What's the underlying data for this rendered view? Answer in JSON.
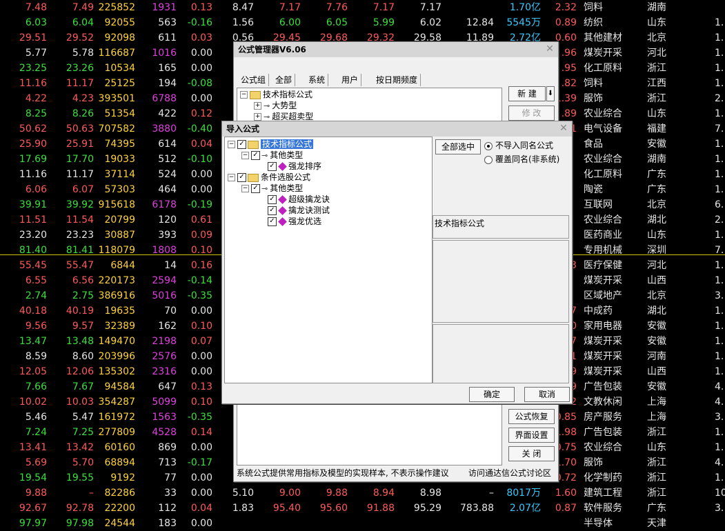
{
  "table": {
    "rows": [
      {
        "c1": "7.48",
        "c2": "7.49",
        "c3": "225852",
        "c4": "1931",
        "c5": "0.13",
        "c6": "8.47",
        "c7": "7.17",
        "c8": "7.76",
        "c9": "7.17",
        "c10": "7.17",
        "c11": "",
        "c12": "1.70亿",
        "c13": "2.32",
        "c14": "饲料",
        "c15": "湖南",
        "c16": ""
      },
      {
        "c1": "6.03",
        "c2": "6.04",
        "c3": "92055",
        "c4": "563",
        "c5": "-0.16",
        "c6": "1.56",
        "c7": "6.00",
        "c8": "6.05",
        "c9": "5.99",
        "c10": "6.02",
        "c11": "12.84",
        "c12": "5545万",
        "c13": "0.89",
        "c14": "纺织",
        "c15": "山东",
        "c16": "1."
      },
      {
        "c1": "29.51",
        "c2": "29.52",
        "c3": "92098",
        "c4": "611",
        "c5": "0.03",
        "c6": "0.56",
        "c7": "29.45",
        "c8": "29.68",
        "c9": "29.32",
        "c10": "29.58",
        "c11": "11.89",
        "c12": "2.72亿",
        "c13": "0.60",
        "c14": "其他建材",
        "c15": "北京",
        "c16": "1."
      },
      {
        "c1": "5.77",
        "c2": "5.78",
        "c3": "116687",
        "c4": "1016",
        "c5": "0.00",
        "c13": ".96",
        "c14": "煤炭开采",
        "c15": "河北",
        "c16": "1."
      },
      {
        "c1": "23.25",
        "c2": "23.26",
        "c3": "10534",
        "c4": "165",
        "c5": "0.00",
        "c13": ".95",
        "c14": "化工原料",
        "c15": "浙江",
        "c16": "1."
      },
      {
        "c1": "11.16",
        "c2": "11.17",
        "c3": "25125",
        "c4": "194",
        "c5": "-0.08",
        "c13": ".82",
        "c14": "饲料",
        "c15": "江西",
        "c16": "1."
      },
      {
        "c1": "4.22",
        "c2": "4.23",
        "c3": "393501",
        "c4": "6788",
        "c5": "0.00",
        "c13": "1.39",
        "c14": "服饰",
        "c15": "浙江",
        "c16": "2."
      },
      {
        "c1": "8.25",
        "c2": "8.26",
        "c3": "51354",
        "c4": "422",
        "c5": "0.12",
        "c13": ".89",
        "c14": "农业综合",
        "c15": "山东",
        "c16": "1."
      },
      {
        "c1": "50.62",
        "c2": "50.63",
        "c3": "707582",
        "c4": "3880",
        "c5": "-0.40",
        "c13": "1",
        "c14": "电气设备",
        "c15": "福建",
        "c16": "7."
      },
      {
        "c1": "25.90",
        "c2": "25.91",
        "c3": "74395",
        "c4": "614",
        "c5": "0.04",
        "c13": "",
        "c14": "食品",
        "c15": "安徽",
        "c16": "1."
      },
      {
        "c1": "17.69",
        "c2": "17.70",
        "c3": "19033",
        "c4": "512",
        "c5": "-0.10",
        "c13": "",
        "c14": "农业综合",
        "c15": "湖南",
        "c16": "1."
      },
      {
        "c1": "11.16",
        "c2": "11.17",
        "c3": "37114",
        "c4": "524",
        "c5": "0.00",
        "c13": "",
        "c14": "化工原料",
        "c15": "广东",
        "c16": "1."
      },
      {
        "c1": "6.06",
        "c2": "6.07",
        "c3": "57303",
        "c4": "464",
        "c5": "0.00",
        "c13": "",
        "c14": "陶瓷",
        "c15": "广东",
        "c16": "1."
      },
      {
        "c1": "39.91",
        "c2": "39.92",
        "c3": "915618",
        "c4": "6178",
        "c5": "-0.19",
        "c13": "",
        "c14": "互联网",
        "c15": "北京",
        "c16": "6."
      },
      {
        "c1": "11.51",
        "c2": "11.54",
        "c3": "20799",
        "c4": "120",
        "c5": "0.61",
        "c13": "",
        "c14": "农业综合",
        "c15": "湖北",
        "c16": "2."
      },
      {
        "c1": "23.20",
        "c2": "23.23",
        "c3": "30887",
        "c4": "393",
        "c5": "0.09",
        "c13": "",
        "c14": "医药商业",
        "c15": "山东",
        "c16": "1."
      },
      {
        "c1": "81.40",
        "c2": "81.41",
        "c3": "118079",
        "c4": "1808",
        "c5": "0.10",
        "c13": "",
        "c14": "专用机械",
        "c15": "深圳",
        "c16": "7."
      },
      {
        "c1": "55.45",
        "c2": "55.47",
        "c3": "6844",
        "c4": "14",
        "c5": "0.16",
        "c13": "3",
        "c14": "医疗保健",
        "c15": "河北",
        "c16": "1."
      },
      {
        "c1": "6.55",
        "c2": "6.56",
        "c3": "220173",
        "c4": "2594",
        "c5": "-0.14",
        "c13": "",
        "c14": "煤炭开采",
        "c15": "山西",
        "c16": "1."
      },
      {
        "c1": "2.74",
        "c2": "2.75",
        "c3": "386916",
        "c4": "5016",
        "c5": "-0.35",
        "c13": "",
        "c14": "区域地产",
        "c15": "北京",
        "c16": "3."
      },
      {
        "c1": "40.18",
        "c2": "40.19",
        "c3": "19635",
        "c4": "70",
        "c5": "0.00",
        "c13": "7",
        "c14": "中成药",
        "c15": "湖北",
        "c16": "1."
      },
      {
        "c1": "9.56",
        "c2": "9.57",
        "c3": "32389",
        "c4": "162",
        "c5": "0.10",
        "c13": "0",
        "c14": "家用电器",
        "c15": "安徽",
        "c16": "1."
      },
      {
        "c1": "13.47",
        "c2": "13.48",
        "c3": "149470",
        "c4": "2198",
        "c5": "0.07",
        "c13": "7",
        "c14": "煤炭开采",
        "c15": "安徽",
        "c16": "1."
      },
      {
        "c1": "8.59",
        "c2": "8.60",
        "c3": "203996",
        "c4": "2576",
        "c5": "0.00",
        "c13": "1",
        "c14": "煤炭开采",
        "c15": "河南",
        "c16": "1."
      },
      {
        "c1": "12.05",
        "c2": "12.06",
        "c3": "135302",
        "c4": "2316",
        "c5": "0.00",
        "c13": "9",
        "c14": "煤炭开采",
        "c15": "山西",
        "c16": "1."
      },
      {
        "c1": "7.66",
        "c2": "7.67",
        "c3": "94584",
        "c4": "647",
        "c5": "0.13",
        "c13": "9",
        "c14": "广告包装",
        "c15": "安徽",
        "c16": "4."
      },
      {
        "c1": "10.02",
        "c2": "10.03",
        "c3": "354287",
        "c4": "5099",
        "c5": "0.10",
        "c13": "2",
        "c14": "文教休闲",
        "c15": "上海",
        "c16": "4."
      },
      {
        "c1": "5.46",
        "c2": "5.47",
        "c3": "161972",
        "c4": "1563",
        "c5": "-0.35",
        "c13": "0.85",
        "c14": "房产服务",
        "c15": "上海",
        "c16": "3."
      },
      {
        "c1": "7.24",
        "c2": "7.25",
        "c3": "277809",
        "c4": "4528",
        "c5": "0.14",
        "c13": "1.98",
        "c14": "广告包装",
        "c15": "浙江",
        "c16": "1."
      },
      {
        "c1": "13.41",
        "c2": "13.42",
        "c3": "60160",
        "c4": "869",
        "c5": "0.00",
        "c13": "0.75",
        "c14": "农业综合",
        "c15": "山东",
        "c16": "1."
      },
      {
        "c1": "5.69",
        "c2": "5.70",
        "c3": "68894",
        "c4": "713",
        "c5": "-0.17",
        "c13": "1.70",
        "c14": "服饰",
        "c15": "浙江",
        "c16": "4."
      },
      {
        "c1": "19.54",
        "c2": "19.55",
        "c3": "9192",
        "c4": "77",
        "c5": "0.00",
        "c13": "0.72",
        "c14": "化学制药",
        "c15": "浙江",
        "c16": "1."
      },
      {
        "c1": "9.88",
        "c2": "–",
        "c3": "82286",
        "c4": "33",
        "c5": "0.00",
        "c6": "5.10",
        "c7": "9.00",
        "c8": "9.88",
        "c9": "8.94",
        "c10": "8.98",
        "c11": "–",
        "c12": "8017万",
        "c13": "1.60",
        "c14": "建筑工程",
        "c15": "浙江",
        "c16": "10."
      },
      {
        "c1": "92.67",
        "c2": "92.78",
        "c3": "22200",
        "c4": "112",
        "c5": "0.04",
        "c6": "1.83",
        "c7": "95.40",
        "c8": "95.60",
        "c9": "91.88",
        "c10": "95.29",
        "c11": "783.88",
        "c12": "2.07亿",
        "c13": "0.87",
        "c14": "软件服务",
        "c15": "广东",
        "c16": "3."
      },
      {
        "c1": "97.97",
        "c2": "97.98",
        "c3": "24544",
        "c4": "183",
        "c5": "0.00",
        "c6": "",
        "c7": "",
        "c8": "",
        "c9": "",
        "c10": "",
        "c11": "",
        "c12": "",
        "c13": "",
        "c14": "半导体",
        "c15": "天津",
        "c16": ""
      }
    ]
  },
  "manager": {
    "title": "公式管理器V6.06",
    "tabs": [
      "公式组",
      "全部",
      "系统",
      "用户",
      "按日期频度"
    ],
    "tree": [
      "技术指标公式",
      "大势型",
      "超买超卖型"
    ],
    "new_btn": "新 建",
    "edit_btn": "修 改",
    "restore_btn": "公式恢复",
    "ui_btn": "界面设置",
    "close_btn": "关 闭",
    "footer_note": "系统公式提供常用指标及模型的实现样本, 不表示操作建议",
    "footer_link": "访问通达信公式讨论区"
  },
  "import": {
    "title": "导入公式",
    "tree": {
      "root1": "技术指标公式",
      "r1_group": "其他类型",
      "r1_item1": "强龙排序",
      "root2": "条件选股公式",
      "r2_group": "其他类型",
      "r2_item1": "超级擒龙诀",
      "r2_item2": "擒龙诀测试",
      "r2_item3": "强龙优选"
    },
    "select_all": "全部选中",
    "opt1": "不导入同名公式",
    "opt2": "覆盖同名(非系统)",
    "info_label": "技术指标公式",
    "ok": "确定",
    "cancel": "取消"
  }
}
